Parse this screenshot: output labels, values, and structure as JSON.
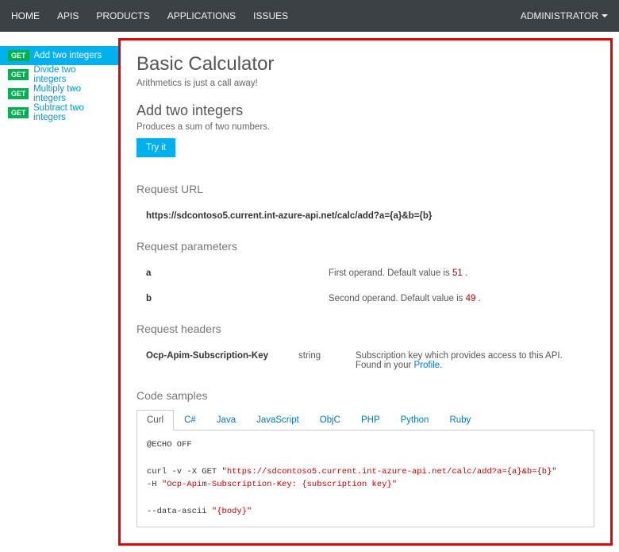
{
  "nav": {
    "items": [
      "HOME",
      "APIS",
      "PRODUCTS",
      "APPLICATIONS",
      "ISSUES"
    ],
    "user": "ADMINISTRATOR"
  },
  "sidebar": {
    "items": [
      {
        "method": "GET",
        "label": "Add two integers",
        "active": true
      },
      {
        "method": "GET",
        "label": "Divide two integers",
        "active": false
      },
      {
        "method": "GET",
        "label": "Multiply two integers",
        "active": false
      },
      {
        "method": "GET",
        "label": "Subtract two integers",
        "active": false
      }
    ]
  },
  "api": {
    "title": "Basic Calculator",
    "subtitle": "Arithmetics is just a call away!",
    "operation_title": "Add two integers",
    "operation_desc": "Produces a sum of two numbers.",
    "tryit_label": "Try it",
    "request_url_heading": "Request URL",
    "request_url": "https://sdcontoso5.current.int-azure-api.net/calc/add?a={a}&b={b}",
    "request_params_heading": "Request parameters",
    "params": [
      {
        "name": "a",
        "desc": "First operand. Default value is ",
        "default": "51",
        "dot": " ."
      },
      {
        "name": "b",
        "desc": "Second operand. Default value is ",
        "default": "49",
        "dot": " ."
      }
    ],
    "request_headers_heading": "Request headers",
    "headers": [
      {
        "name": "Ocp-Apim-Subscription-Key",
        "type": "string",
        "desc_pre": "Subscription key which provides access to this API. Found in your ",
        "link": "Profile",
        "desc_post": "."
      }
    ],
    "code_samples_heading": "Code samples",
    "code_tabs": [
      "Curl",
      "C#",
      "Java",
      "JavaScript",
      "ObjC",
      "PHP",
      "Python",
      "Ruby"
    ],
    "code_active_tab": 0,
    "code": {
      "l1": "@ECHO OFF",
      "l2a": "curl -v -X GET ",
      "l2b": "\"https://sdcontoso5.current.int-azure-api.net/calc/add?a={a}&b={b}\"",
      "l3a": "-H ",
      "l3b": "\"Ocp-Apim-Subscription-Key: {subscription key}\"",
      "l4a": "--data-ascii ",
      "l4b": "\"{body}\""
    }
  }
}
